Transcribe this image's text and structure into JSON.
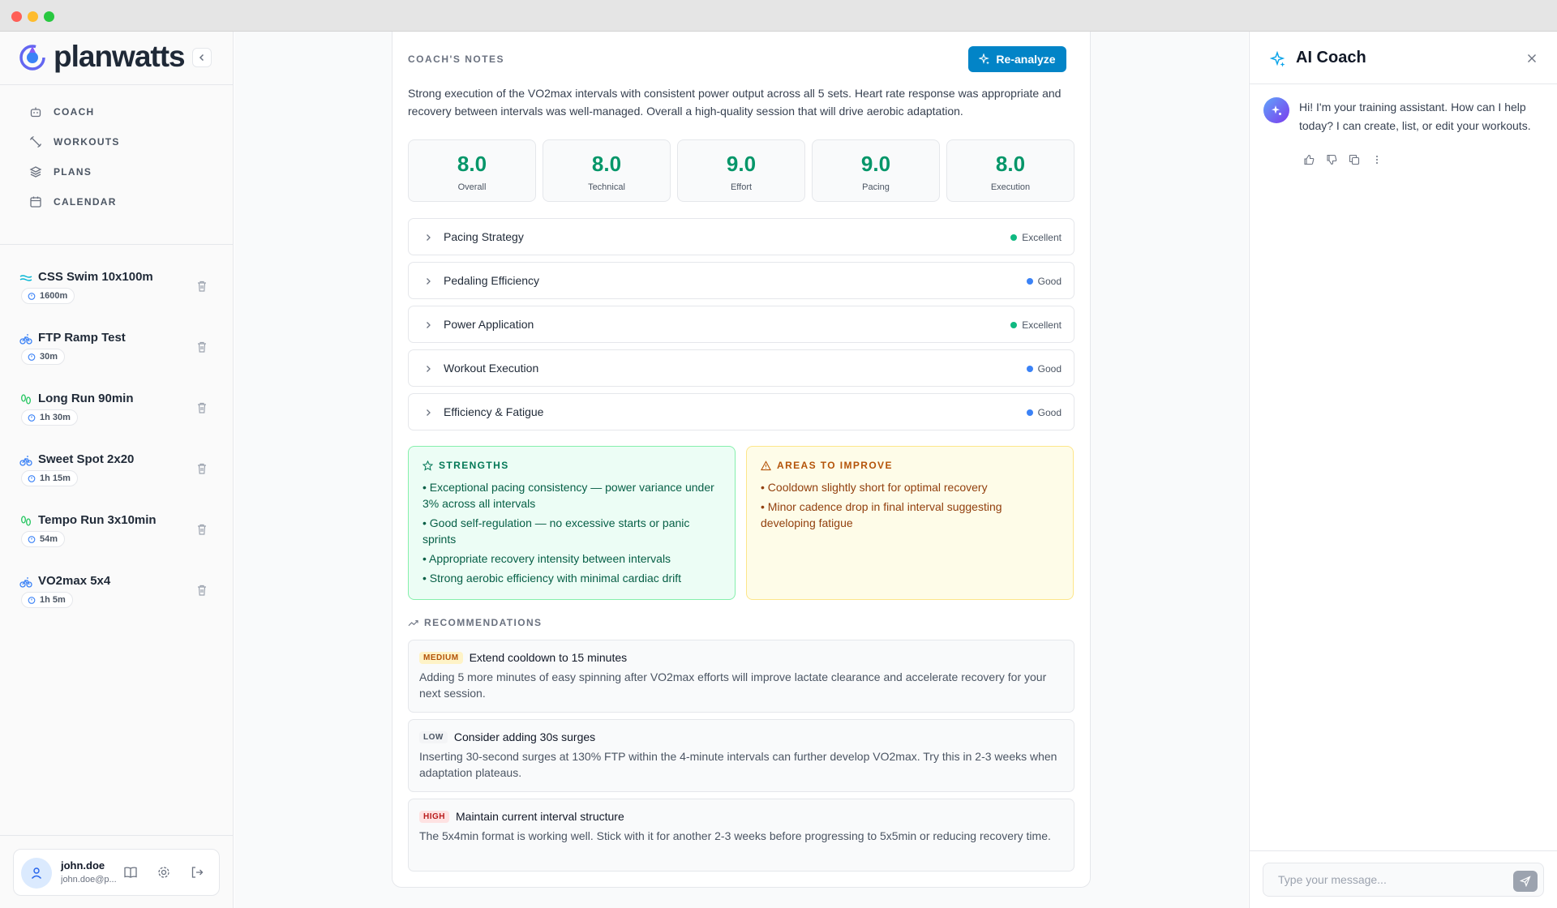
{
  "brand": {
    "name": "planwatts"
  },
  "nav": [
    {
      "label": "COACH",
      "icon": "bot-icon"
    },
    {
      "label": "WORKOUTS",
      "icon": "workouts-icon"
    },
    {
      "label": "PLANS",
      "icon": "layers-icon"
    },
    {
      "label": "CALENDAR",
      "icon": "calendar-icon"
    }
  ],
  "workouts": [
    {
      "title": "CSS Swim 10x100m",
      "badge": "1600m",
      "sport": "swim"
    },
    {
      "title": "FTP Ramp Test",
      "badge": "30m",
      "sport": "bike"
    },
    {
      "title": "Long Run 90min",
      "badge": "1h 30m",
      "sport": "run"
    },
    {
      "title": "Sweet Spot 2x20",
      "badge": "1h 15m",
      "sport": "bike"
    },
    {
      "title": "Tempo Run 3x10min",
      "badge": "54m",
      "sport": "run"
    },
    {
      "title": "VO2max 5x4",
      "badge": "1h 5m",
      "sport": "bike"
    }
  ],
  "user": {
    "name": "john.doe",
    "email": "john.doe@p..."
  },
  "notes": {
    "title": "COACH'S NOTES",
    "reanalyze_label": "Re-analyze",
    "summary": "Strong execution of the VO2max intervals with consistent power output across all 5 sets. Heart rate response was appropriate and recovery between intervals was well-managed. Overall a high-quality session that will drive aerobic adaptation.",
    "scores": [
      {
        "value": "8.0",
        "label": "Overall"
      },
      {
        "value": "8.0",
        "label": "Technical"
      },
      {
        "value": "9.0",
        "label": "Effort"
      },
      {
        "value": "9.0",
        "label": "Pacing"
      },
      {
        "value": "8.0",
        "label": "Execution"
      }
    ],
    "sections": [
      {
        "title": "Pacing Strategy",
        "status": "Excellent",
        "color": "#10b981"
      },
      {
        "title": "Pedaling Efficiency",
        "status": "Good",
        "color": "#3b82f6"
      },
      {
        "title": "Power Application",
        "status": "Excellent",
        "color": "#10b981"
      },
      {
        "title": "Workout Execution",
        "status": "Good",
        "color": "#3b82f6"
      },
      {
        "title": "Efficiency & Fatigue",
        "status": "Good",
        "color": "#3b82f6"
      }
    ],
    "strengths": {
      "title": "STRENGTHS",
      "items": [
        "• Exceptional pacing consistency — power variance under 3% across all intervals",
        "• Good self-regulation — no excessive starts or panic sprints",
        "• Appropriate recovery intensity between intervals",
        "• Strong aerobic efficiency with minimal cardiac drift"
      ]
    },
    "improve": {
      "title": "AREAS TO IMPROVE",
      "items": [
        "• Cooldown slightly short for optimal recovery",
        "• Minor cadence drop in final interval suggesting developing fatigue"
      ]
    },
    "recommendations_title": "RECOMMENDATIONS",
    "recommendations": [
      {
        "priority": "MEDIUM",
        "level": "medium",
        "title": "Extend cooldown to 15 minutes",
        "desc": "Adding 5 more minutes of easy spinning after VO2max efforts will improve lactate clearance and accelerate recovery for your next session."
      },
      {
        "priority": "LOW",
        "level": "low",
        "title": "Consider adding 30s surges",
        "desc": "Inserting 30-second surges at 130% FTP within the 4-minute intervals can further develop VO2max. Try this in 2-3 weeks when adaptation plateaus."
      },
      {
        "priority": "HIGH",
        "level": "high",
        "title": "Maintain current interval structure",
        "desc": "The 5x4min format is working well. Stick with it for another 2-3 weeks before progressing to 5x5min or reducing recovery time."
      }
    ]
  },
  "chat": {
    "title": "AI Coach",
    "message": "Hi! I'm your training assistant. How can I help today? I can create, list, or edit your workouts.",
    "placeholder": "Type your message..."
  },
  "colors": {
    "accent": "#0284c7",
    "score": "#059669"
  }
}
